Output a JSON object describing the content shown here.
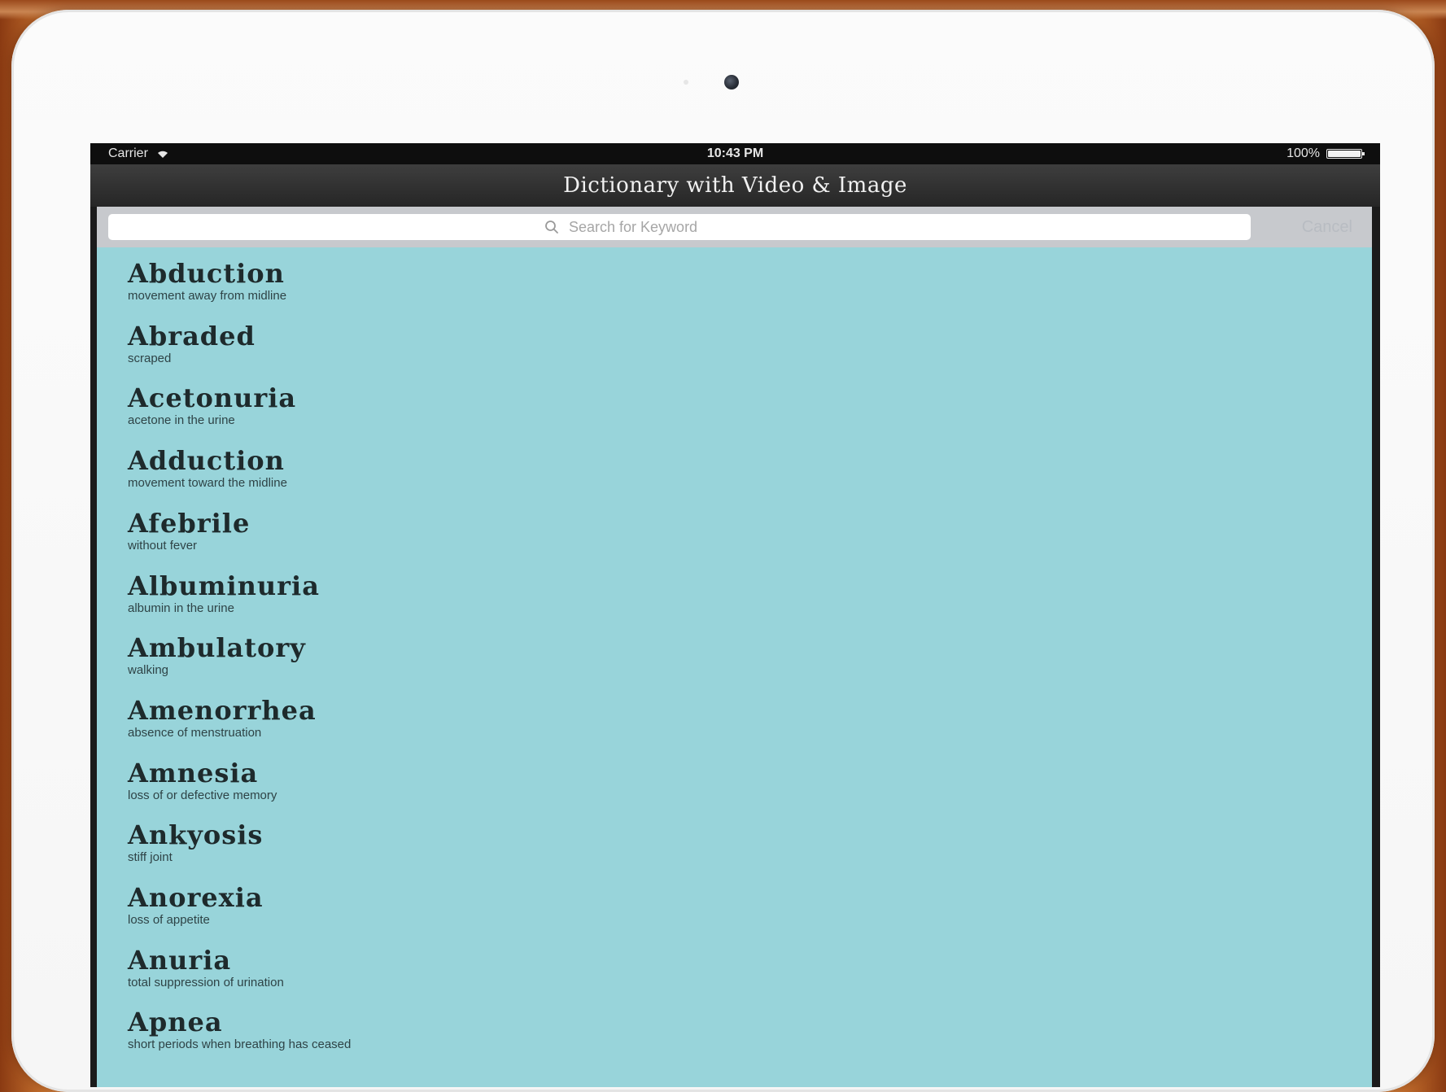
{
  "status_bar": {
    "carrier": "Carrier",
    "time": "10:43 PM",
    "battery": "100%",
    "battery_level": 1.0
  },
  "nav": {
    "title": "Dictionary with Video & Image"
  },
  "search": {
    "placeholder": "Search for Keyword",
    "value": "",
    "cancel_label": "Cancel"
  },
  "entries": [
    {
      "term": "Abduction",
      "definition": "movement away from midline"
    },
    {
      "term": "Abraded",
      "definition": "scraped"
    },
    {
      "term": "Acetonuria",
      "definition": "acetone in the urine"
    },
    {
      "term": "Adduction",
      "definition": "movement toward the midline"
    },
    {
      "term": "Afebrile",
      "definition": "without fever"
    },
    {
      "term": "Albuminuria",
      "definition": "albumin in the urine"
    },
    {
      "term": "Ambulatory",
      "definition": "walking"
    },
    {
      "term": "Amenorrhea",
      "definition": "absence of menstruation"
    },
    {
      "term": "Amnesia",
      "definition": "loss of or defective memory"
    },
    {
      "term": "Ankyosis",
      "definition": "stiff joint"
    },
    {
      "term": "Anorexia",
      "definition": "loss of appetite"
    },
    {
      "term": "Anuria",
      "definition": "total suppression of urination"
    },
    {
      "term": "Apnea",
      "definition": "short periods when breathing has ceased"
    }
  ],
  "colors": {
    "list_background": "#98d4da",
    "nav_background": "#2e2e2e",
    "search_bar_background": "#c7c9cd"
  },
  "icons": {
    "wifi": "wifi-icon",
    "search": "search-icon",
    "camera": "camera-icon"
  }
}
